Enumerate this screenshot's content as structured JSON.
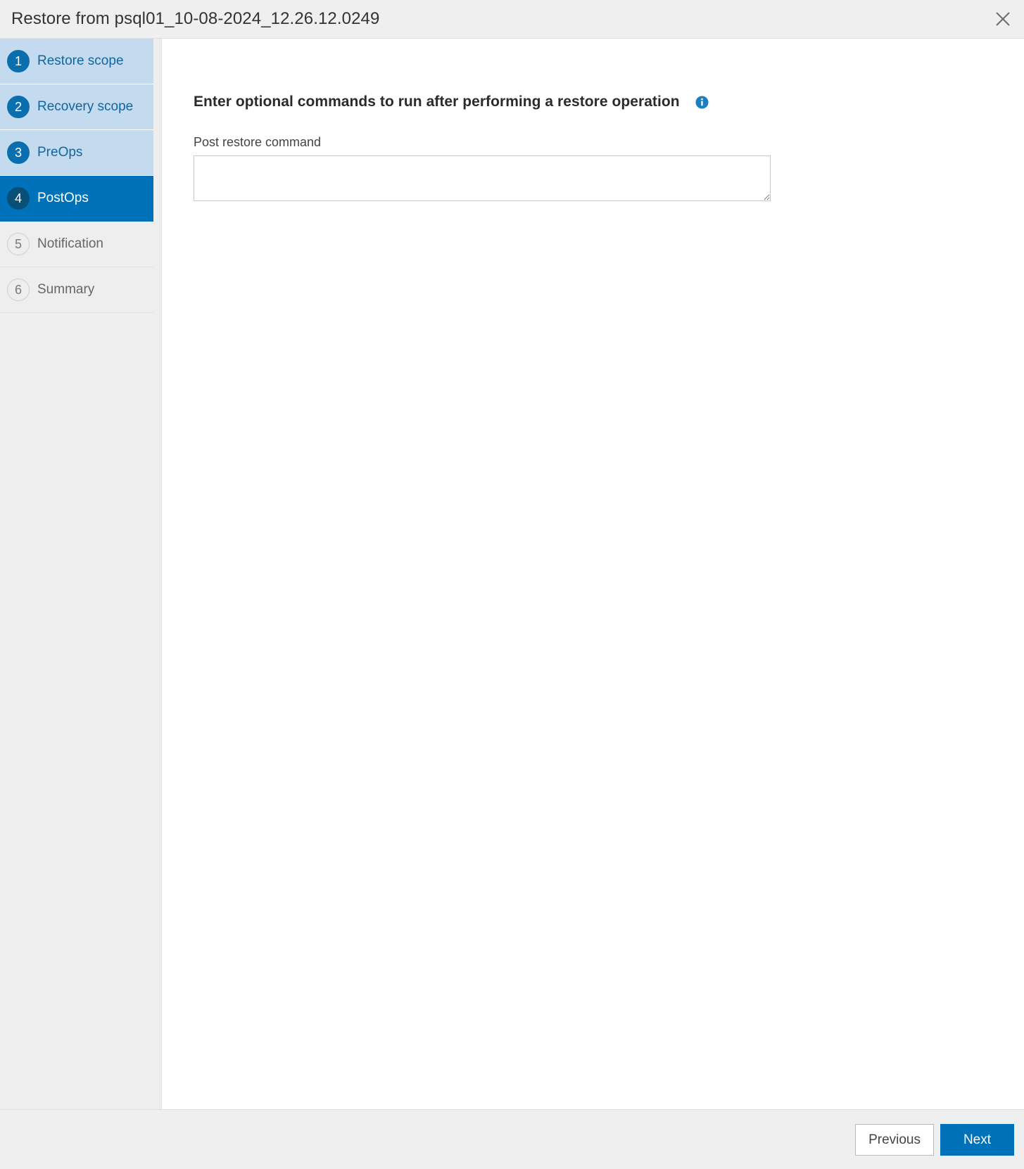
{
  "dialog": {
    "title": "Restore from psql01_10-08-2024_12.26.12.0249",
    "close_label": "Close"
  },
  "sidebar": {
    "items": [
      {
        "number": "1",
        "label": "Restore scope",
        "state": "visited"
      },
      {
        "number": "2",
        "label": "Recovery scope",
        "state": "visited"
      },
      {
        "number": "3",
        "label": "PreOps",
        "state": "visited"
      },
      {
        "number": "4",
        "label": "PostOps",
        "state": "active"
      },
      {
        "number": "5",
        "label": "Notification",
        "state": "plain"
      },
      {
        "number": "6",
        "label": "Summary",
        "state": "plain"
      }
    ]
  },
  "content": {
    "heading": "Enter optional commands to run after performing a restore operation",
    "info_tooltip": "i",
    "field_label": "Post restore command",
    "command_value": "",
    "command_placeholder": ""
  },
  "footer": {
    "previous_label": "Previous",
    "next_label": "Next"
  },
  "colors": {
    "accent": "#0072b9",
    "accent_dark": "#0a4f77",
    "visited_bg": "#c4dbef",
    "visited_text": "#12659e",
    "panel_gray": "#efefef",
    "sidebar_gray": "#eeeeee"
  }
}
